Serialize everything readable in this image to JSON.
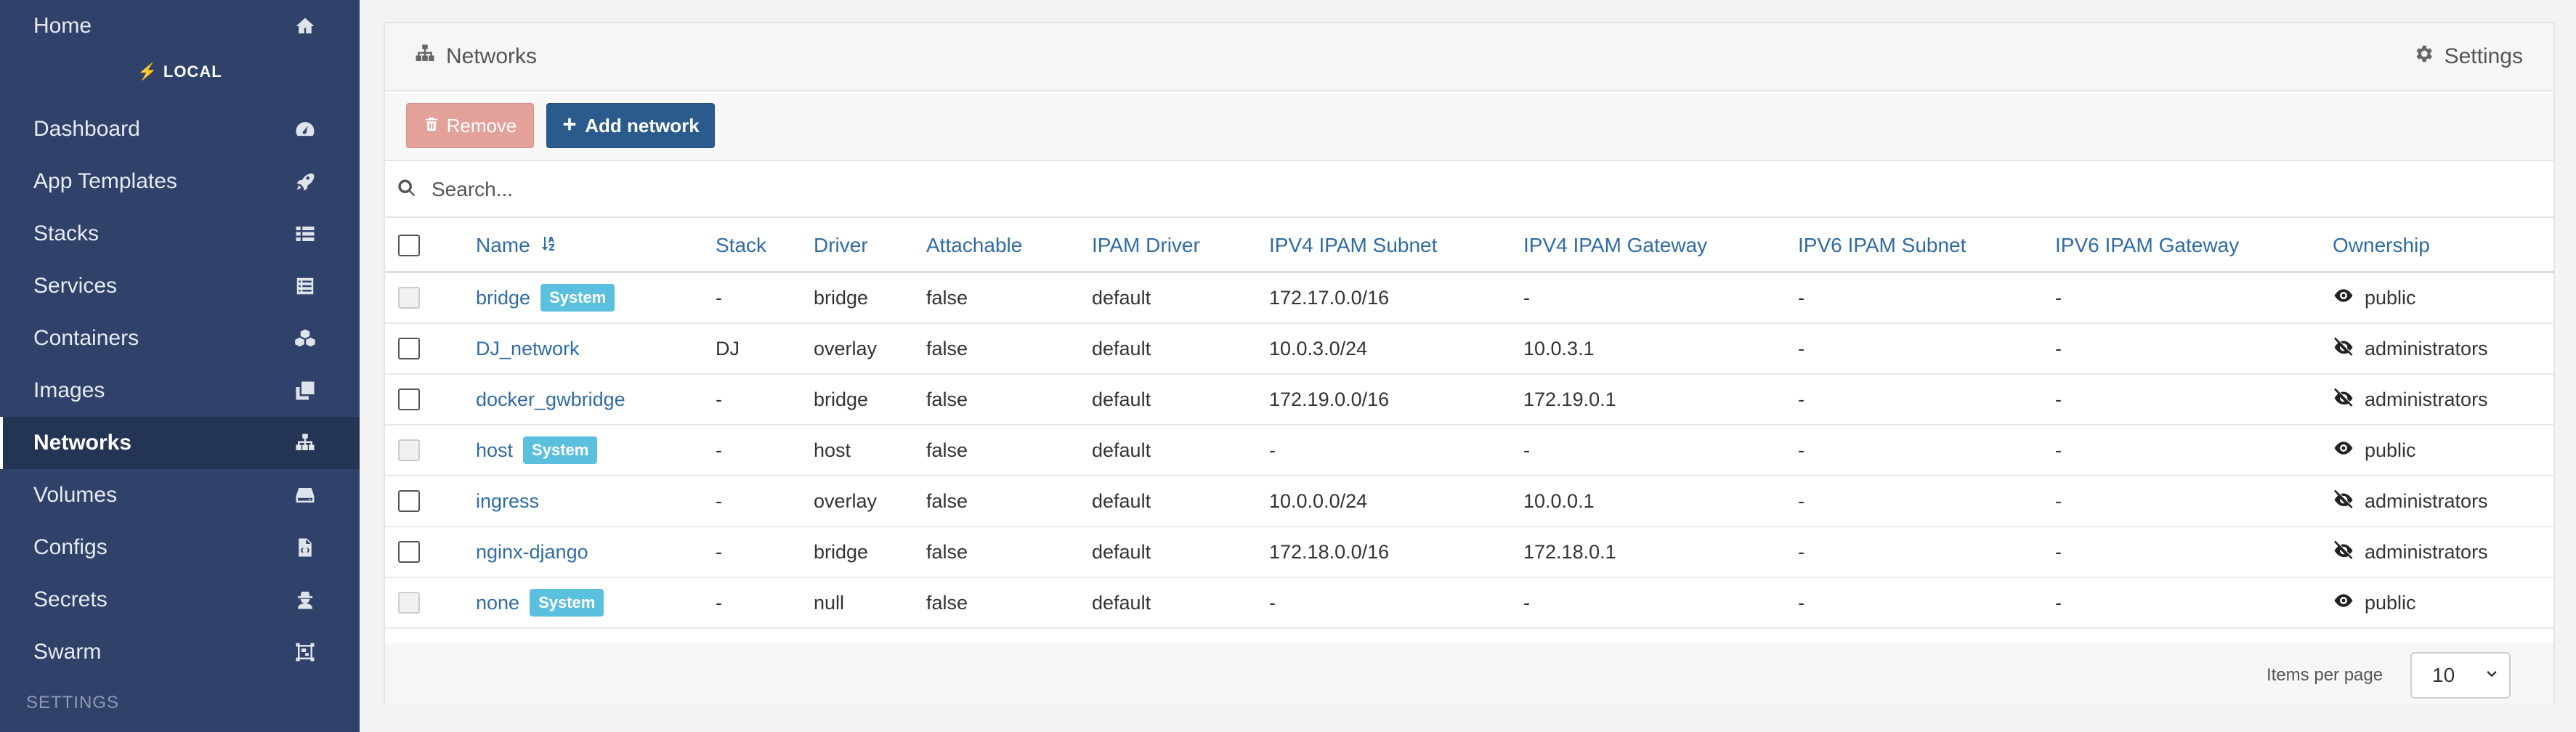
{
  "sidebar": {
    "endpoint": "LOCAL",
    "section_settings": "SETTINGS",
    "items": [
      {
        "label": "Home",
        "icon": "home-icon"
      },
      {
        "label": "Dashboard",
        "icon": "tachometer-icon"
      },
      {
        "label": "App Templates",
        "icon": "rocket-icon"
      },
      {
        "label": "Stacks",
        "icon": "th-list-icon"
      },
      {
        "label": "Services",
        "icon": "list-alt-icon"
      },
      {
        "label": "Containers",
        "icon": "cubes-icon"
      },
      {
        "label": "Images",
        "icon": "clone-icon"
      },
      {
        "label": "Networks",
        "icon": "sitemap-icon",
        "active": true
      },
      {
        "label": "Volumes",
        "icon": "hdd-icon"
      },
      {
        "label": "Configs",
        "icon": "file-code-icon"
      },
      {
        "label": "Secrets",
        "icon": "user-secret-icon"
      },
      {
        "label": "Swarm",
        "icon": "object-group-icon"
      }
    ]
  },
  "panel": {
    "title": "Networks",
    "settings_label": "Settings",
    "remove_label": "Remove",
    "add_label": "Add network",
    "search_placeholder": "Search..."
  },
  "table": {
    "columns": [
      "Name",
      "Stack",
      "Driver",
      "Attachable",
      "IPAM Driver",
      "IPV4 IPAM Subnet",
      "IPV4 IPAM Gateway",
      "IPV6 IPAM Subnet",
      "IPV6 IPAM Gateway",
      "Ownership"
    ],
    "rows": [
      {
        "name": "bridge",
        "system": true,
        "stack": "-",
        "driver": "bridge",
        "attachable": "false",
        "ipam_driver": "default",
        "ipv4_subnet": "172.17.0.0/16",
        "ipv4_gateway": "-",
        "ipv6_subnet": "-",
        "ipv6_gateway": "-",
        "ownership": "public"
      },
      {
        "name": "DJ_network",
        "system": false,
        "stack": "DJ",
        "driver": "overlay",
        "attachable": "false",
        "ipam_driver": "default",
        "ipv4_subnet": "10.0.3.0/24",
        "ipv4_gateway": "10.0.3.1",
        "ipv6_subnet": "-",
        "ipv6_gateway": "-",
        "ownership": "administrators"
      },
      {
        "name": "docker_gwbridge",
        "system": false,
        "stack": "-",
        "driver": "bridge",
        "attachable": "false",
        "ipam_driver": "default",
        "ipv4_subnet": "172.19.0.0/16",
        "ipv4_gateway": "172.19.0.1",
        "ipv6_subnet": "-",
        "ipv6_gateway": "-",
        "ownership": "administrators"
      },
      {
        "name": "host",
        "system": true,
        "stack": "-",
        "driver": "host",
        "attachable": "false",
        "ipam_driver": "default",
        "ipv4_subnet": "-",
        "ipv4_gateway": "-",
        "ipv6_subnet": "-",
        "ipv6_gateway": "-",
        "ownership": "public"
      },
      {
        "name": "ingress",
        "system": false,
        "stack": "-",
        "driver": "overlay",
        "attachable": "false",
        "ipam_driver": "default",
        "ipv4_subnet": "10.0.0.0/24",
        "ipv4_gateway": "10.0.0.1",
        "ipv6_subnet": "-",
        "ipv6_gateway": "-",
        "ownership": "administrators"
      },
      {
        "name": "nginx-django",
        "system": false,
        "stack": "-",
        "driver": "bridge",
        "attachable": "false",
        "ipam_driver": "default",
        "ipv4_subnet": "172.18.0.0/16",
        "ipv4_gateway": "172.18.0.1",
        "ipv6_subnet": "-",
        "ipv6_gateway": "-",
        "ownership": "administrators"
      },
      {
        "name": "none",
        "system": true,
        "stack": "-",
        "driver": "null",
        "attachable": "false",
        "ipam_driver": "default",
        "ipv4_subnet": "-",
        "ipv4_gateway": "-",
        "ipv6_subnet": "-",
        "ipv6_gateway": "-",
        "ownership": "public"
      }
    ],
    "system_badge": "System"
  },
  "pagination": {
    "label": "Items per page",
    "value": "10"
  },
  "colors": {
    "sidebar_bg": "#30426a",
    "sidebar_active": "#243454",
    "link": "#2f6ba5",
    "badge": "#5bc0de",
    "remove_btn": "#e3a19a",
    "add_btn": "#2a5b8c"
  }
}
